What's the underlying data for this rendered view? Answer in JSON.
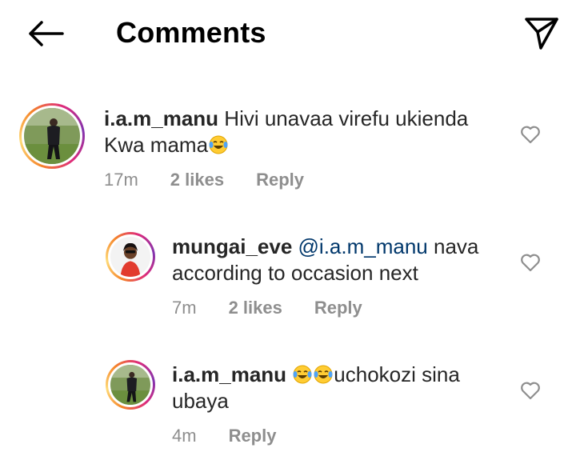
{
  "header": {
    "title": "Comments"
  },
  "comments": [
    {
      "username": "i.a.m_manu",
      "text": "Hivi unavaa virefu ukienda",
      "text_line2": "Kwa mama",
      "time": "17m",
      "likes": "2 likes",
      "reply": "Reply"
    },
    {
      "username": "mungai_eve",
      "mention": "@i.a.m_manu",
      "text": "nava",
      "text_line2": "according to occasion next",
      "time": "7m",
      "likes": "2 likes",
      "reply": "Reply"
    },
    {
      "username": "i.a.m_manu",
      "text": "uchokozi sina",
      "text_line2": "ubaya",
      "time": "4m",
      "reply": "Reply"
    }
  ],
  "colors": {
    "text": "#262626",
    "muted": "#8e8e8e",
    "mention": "#00376b"
  },
  "icons": [
    "back-arrow-icon",
    "direct-send-icon",
    "heart-outline-icon",
    "tears-of-joy-emoji"
  ]
}
